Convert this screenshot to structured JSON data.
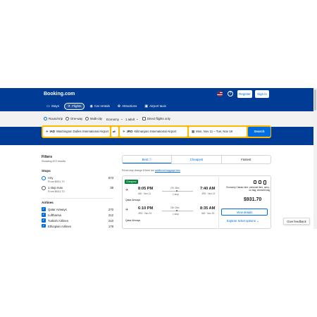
{
  "header": {
    "logo": "Booking.com",
    "help_glyph": "?",
    "register_label": "Register",
    "signin_label": "Sign in",
    "nav": [
      {
        "label": "Stays",
        "icon": "bed-icon"
      },
      {
        "label": "Flights",
        "icon": "plane-icon",
        "active": true
      },
      {
        "label": "Car rentals",
        "icon": "car-icon"
      },
      {
        "label": "Attractions",
        "icon": "attractions-icon"
      },
      {
        "label": "Airport taxis",
        "icon": "taxi-icon"
      }
    ]
  },
  "trip_options": {
    "round_trip": "Round-trip",
    "one_way": "One-way",
    "multi_city": "Multi-city",
    "cabin": "Economy",
    "passengers": "1 adult",
    "direct_only": "Direct flights only"
  },
  "search": {
    "from_code": "IAD",
    "from_name": "Washington Dulles International Airport",
    "to_code": "JRO",
    "to_name": "Kilimanjaro International Airport",
    "dates": "Mon, Nov 11 – Tue, Nov 19",
    "button": "Search"
  },
  "filters": {
    "title": "Filters",
    "showing": "Showing 672 results",
    "stops_title": "Stops",
    "stops": [
      {
        "label": "Any",
        "sub": "From $931.70",
        "count": "673",
        "selected": true
      },
      {
        "label": "1 stop max",
        "sub": "From $931.70",
        "count": "38",
        "selected": false
      }
    ],
    "airlines_title": "Airlines",
    "airlines": [
      {
        "label": "Qatar Airways",
        "count": "270"
      },
      {
        "label": "Lufthansa",
        "count": "212"
      },
      {
        "label": "Turkish Airlines",
        "count": "210"
      },
      {
        "label": "Ethiopian Airlines",
        "count": "178"
      }
    ]
  },
  "sort": {
    "best": "Best",
    "cheapest": "Cheapest",
    "fastest": "Fastest",
    "note": "Prices may change if there are",
    "note_link": "additional baggage fees"
  },
  "result": {
    "badge": "Cheapest",
    "outbound": {
      "depart_time": "8:05 PM",
      "depart_info": "IAD · Nov 11",
      "duration": "27h 35m",
      "stops": "1 stop",
      "arrive_time": "7:40 AM",
      "arrive_info": "JRO · Nov 13",
      "airline": "Qatar Airways"
    },
    "inbound": {
      "depart_time": "6:10 PM",
      "depart_info": "JRO · Nov 19",
      "duration": "22h 25m",
      "stops": "1 stop",
      "arrive_time": "8:35 AM",
      "arrive_info": "IAD · Nov 20",
      "airline": "Qatar Airways"
    },
    "baggage_text": "Economy Classic fare: personal item, carry-on bag, checked bag",
    "price": "$931.70",
    "view_details": "View details",
    "explore": "Explore ticket options"
  },
  "feedback": "Give feedback",
  "colors": {
    "brand": "#003b95",
    "accent": "#006ce4",
    "search_border": "#ffb700",
    "badge": "#008234"
  }
}
